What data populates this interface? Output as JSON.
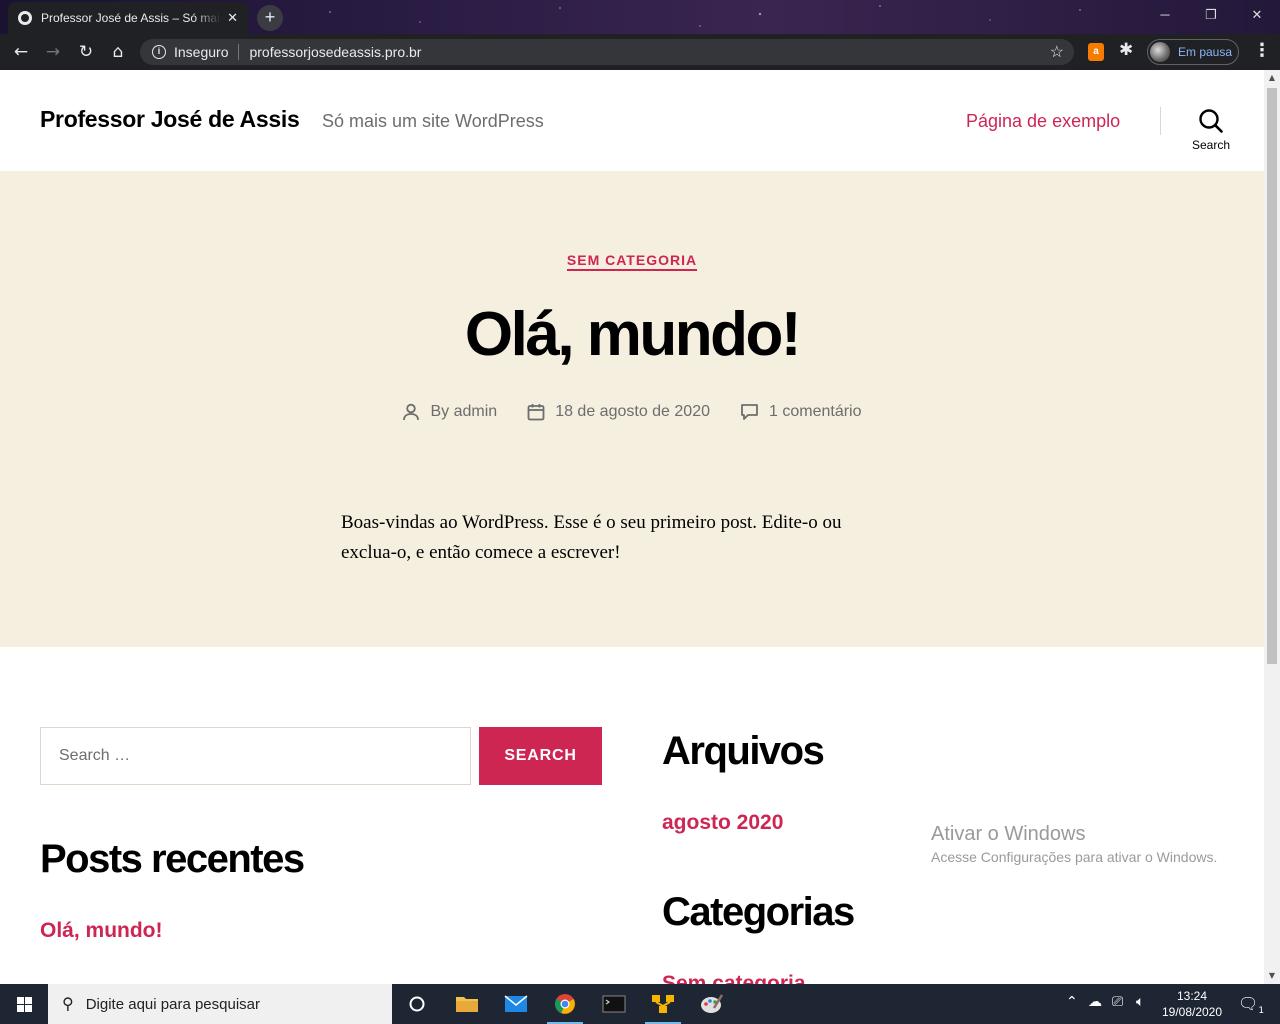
{
  "browser": {
    "tab_title": "Professor José de Assis – Só mais um site WordPress",
    "tab_close": "✕",
    "new_tab": "+",
    "security_label": "Inseguro",
    "url": "professorjosedeassis.pro.br",
    "profile_status": "Em pausa",
    "extension_badge": "a"
  },
  "site": {
    "title": "Professor José de Assis",
    "tagline": "Só mais um site WordPress",
    "nav_link": "Página de exemplo",
    "search_label": "Search"
  },
  "post": {
    "category": "SEM CATEGORIA",
    "title": "Olá, mundo!",
    "author": "By admin",
    "date": "18 de agosto de 2020",
    "comments": "1 comentário",
    "excerpt": "Boas-vindas ao WordPress. Esse é o seu primeiro post. Edite-o ou exclua-o, e então comece a escrever!"
  },
  "widgets": {
    "search_placeholder": "Search …",
    "search_button": "SEARCH",
    "recent_title": "Posts recentes",
    "recent_items": [
      "Olá, mundo!"
    ],
    "archives_title": "Arquivos",
    "archive_items": [
      "agosto 2020"
    ],
    "categories_title": "Categorias",
    "category_items": [
      "Sem categoria"
    ]
  },
  "watermark": {
    "line1": "Ativar o Windows",
    "line2": "Acesse Configurações para ativar o Windows."
  },
  "taskbar": {
    "search_placeholder": "Digite aqui para pesquisar",
    "time": "13:24",
    "date": "19/08/2020",
    "notification_count": "1"
  },
  "colors": {
    "accent": "#cd2653",
    "hero_bg": "#f5efe0",
    "chrome_bg": "#202124"
  }
}
